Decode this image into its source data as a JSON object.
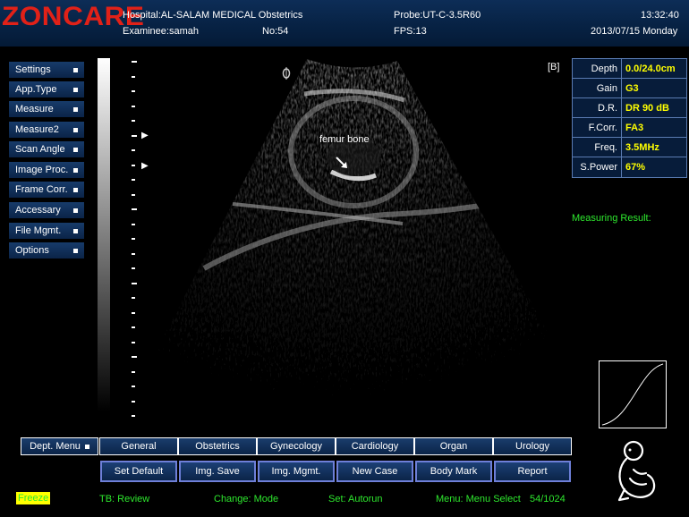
{
  "header": {
    "logo": "ZONCARE",
    "hospital": "Hospital:AL-SALAM MEDICAL Obstetrics",
    "examinee": "Examinee:samah",
    "number": "No:54",
    "probe": "Probe:UT-C-3.5R60",
    "fps": "FPS:13",
    "time": "13:32:40",
    "date": "2013/07/15 Monday"
  },
  "left_menu": [
    {
      "label": "Settings"
    },
    {
      "label": "App.Type"
    },
    {
      "label": "Measure"
    },
    {
      "label": "Measure2"
    },
    {
      "label": "Scan Angle"
    },
    {
      "label": "Image Proc."
    },
    {
      "label": "Frame Corr."
    },
    {
      "label": "Accessary"
    },
    {
      "label": "File Mgmt."
    },
    {
      "label": "Options"
    }
  ],
  "image": {
    "annotation": "femur bone",
    "mark_b": "[B]"
  },
  "params": [
    {
      "name": "Depth",
      "value": "0.0/24.0cm"
    },
    {
      "name": "Gain",
      "value": "G3"
    },
    {
      "name": "D.R.",
      "value": "DR 90 dB"
    },
    {
      "name": "F.Corr.",
      "value": "FA3"
    },
    {
      "name": "Freq.",
      "value": "3.5MHz"
    },
    {
      "name": "S.Power",
      "value": "67%"
    }
  ],
  "measuring_result": "Measuring Result:",
  "dept_menu": {
    "label": "Dept. Menu",
    "items": [
      "General",
      "Obstetrics",
      "Gynecology",
      "Cardiology",
      "Organ",
      "Urology"
    ]
  },
  "actions": [
    "Set Default",
    "Img. Save",
    "Img. Mgmt.",
    "New Case",
    "Body Mark",
    "Report"
  ],
  "status": {
    "freeze": "Freeze",
    "tb": "TB: Review",
    "change": "Change: Mode",
    "set": "Set: Autorun",
    "menu": "Menu: Menu Select",
    "count": "54/1024"
  },
  "colors": {
    "header_bg": "#072244",
    "logo": "#e12118",
    "param_value": "#ffff00",
    "status_text": "#2ee82e",
    "action_border": "#6e7fd8"
  }
}
